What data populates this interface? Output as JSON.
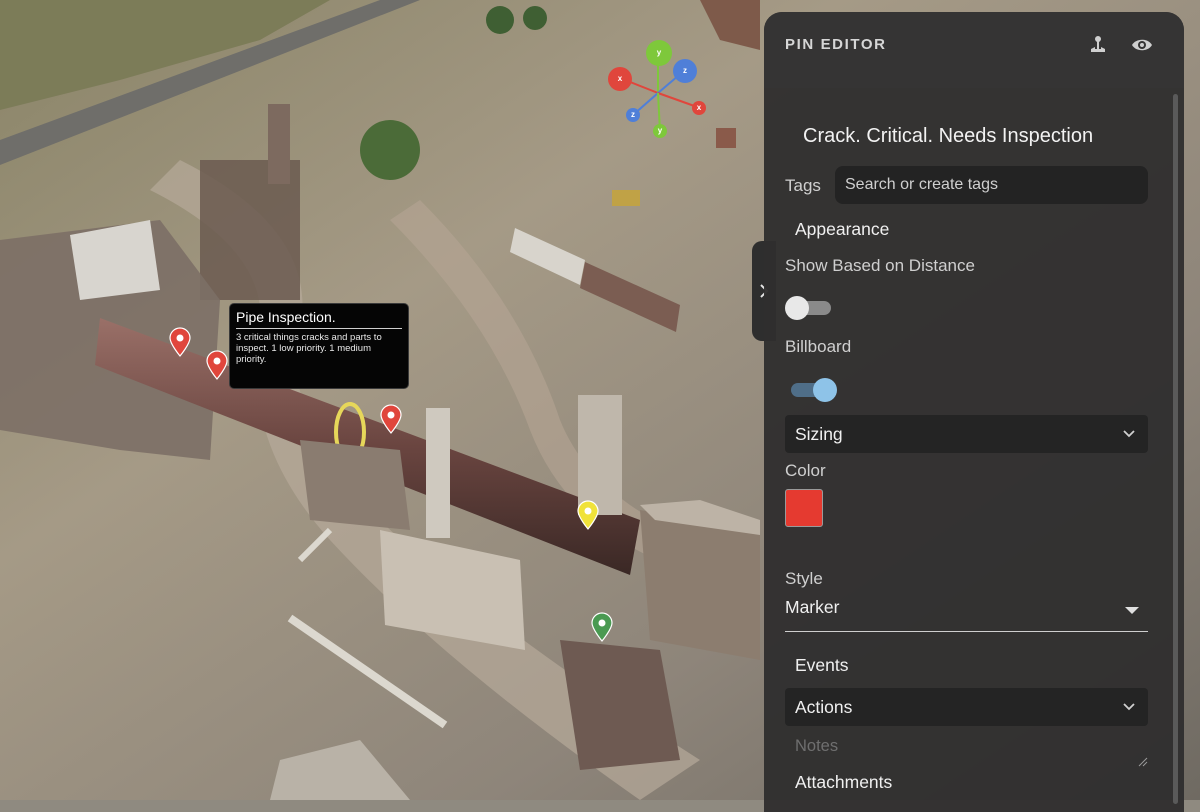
{
  "tooltip": {
    "title": "Pipe Inspection.",
    "body": "3 critical things cracks and parts to inspect. 1 low priority. 1 medium priority."
  },
  "gizmo": {
    "axis_labels": [
      "x",
      "y",
      "z",
      "x",
      "z",
      "y"
    ]
  },
  "pins": {
    "colors": {
      "red": "#e0463c",
      "yellow": "#f0e23a",
      "green": "#4a9a52"
    }
  },
  "panel": {
    "title": "PIN EDITOR",
    "header_icons": [
      "anchor-pin-icon",
      "eye-icon"
    ],
    "pin_name": "Crack. Critical. Needs Inspection",
    "tags": {
      "label": "Tags",
      "placeholder": "Search or create tags"
    },
    "appearance": {
      "heading": "Appearance",
      "show_based_on_distance": {
        "label": "Show Based on Distance",
        "enabled": false
      },
      "billboard": {
        "label": "Billboard",
        "enabled": true
      },
      "sizing": {
        "label": "Sizing"
      },
      "color": {
        "label": "Color",
        "value": "#e53a30"
      },
      "style": {
        "label": "Style",
        "value": "Marker"
      }
    },
    "events": {
      "heading": "Events"
    },
    "actions": {
      "label": "Actions"
    },
    "notes": {
      "placeholder": "Notes"
    },
    "attachments": {
      "heading": "Attachments"
    }
  },
  "colors": {
    "panel_bg": "#302f2f",
    "toggle_on": "#8ec3e8",
    "toggle_off": "#e8e8e8"
  }
}
